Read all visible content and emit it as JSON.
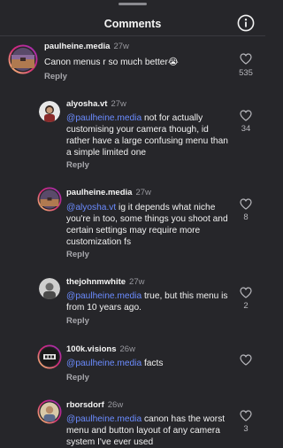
{
  "header": {
    "title": "Comments"
  },
  "comments": [
    {
      "username": "paulheine.media",
      "time": "27w",
      "mention": "",
      "text": "Canon menus r so much better😭",
      "reply": "Reply",
      "likes": "535"
    },
    {
      "username": "alyosha.vt",
      "time": "27w",
      "mention": "@paulheine.media",
      "text": " not for actually customising your camera though, id rather have a large confusing menu than a simple limited one",
      "reply": "Reply",
      "likes": "34"
    },
    {
      "username": "paulheine.media",
      "time": "27w",
      "mention": "@alyosha.vt",
      "text": " ig it depends what niche you're in too, some things you shoot and certain settings may require more customization fs",
      "reply": "Reply",
      "likes": "8"
    },
    {
      "username": "thejohnmwhite",
      "time": "27w",
      "mention": "@paulheine.media",
      "text": " true, but this menu is from 10 years ago.",
      "reply": "Reply",
      "likes": "2"
    },
    {
      "username": "100k.visions",
      "time": "26w",
      "mention": "@paulheine.media",
      "text": " facts",
      "reply": "Reply",
      "likes": ""
    },
    {
      "username": "rborsdorf",
      "time": "26w",
      "mention": "@paulheine.media",
      "text": " canon has the worst menu and button layout of any camera system I've ever used",
      "reply": "",
      "likes": "3"
    }
  ],
  "colors": {
    "background": "#26262a",
    "mention": "#6b8cff",
    "muted": "#9a9aa0",
    "story_ring": "#d62976"
  },
  "icons": {
    "info": "info-circle-icon",
    "like": "heart-outline-icon"
  }
}
